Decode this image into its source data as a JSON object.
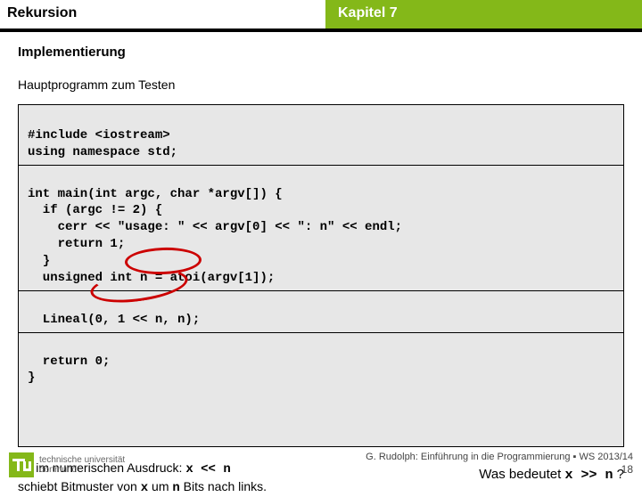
{
  "header": {
    "left": "Rekursion",
    "right": "Kapitel 7"
  },
  "section": {
    "title": "Implementierung",
    "subtitle": "Hauptprogramm zum Testen"
  },
  "code": {
    "block1": "#include <iostream>\nusing namespace std;",
    "block2": "int main(int argc, char *argv[]) {\n  if (argc != 2) {\n    cerr << \"usage: \" << argv[0] << \": n\" << endl;\n    return 1;\n  }\n  unsigned int n = atoi(argv[1]);",
    "block3": "  Lineal(0, 1 << n, n);",
    "block4": "  return 0;\n}"
  },
  "note": {
    "shift_expr_1": "x << n",
    "line1_prefix": "<< im numerischen Ausdruck: ",
    "line2_prefix": "schiebt Bitmuster von ",
    "var_x": "x",
    "mid": " um ",
    "var_n": "n",
    "line2_suffix": " Bits nach links."
  },
  "question": {
    "prefix": "Was bedeutet ",
    "expr": "x >> n",
    "suffix": " ?"
  },
  "footer": {
    "uni1": "technische universität",
    "uni2": "dortmund",
    "credit": "G. Rudolph: Einführung in die Programmierung ▪ WS 2013/14",
    "page": "18"
  }
}
